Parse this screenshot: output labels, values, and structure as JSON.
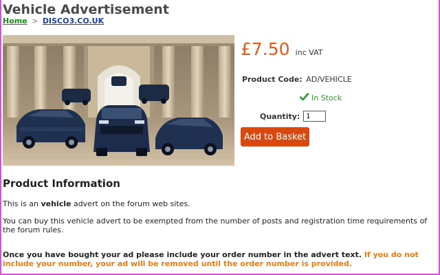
{
  "page": {
    "title": "Vehicle Advertisement"
  },
  "breadcrumb": {
    "home": "Home",
    "separator": ">",
    "current": "DISCO3.CO.UK"
  },
  "product": {
    "image_alt": "Range Rover vehicles in front of a stately building",
    "price": "£7.50",
    "price_suffix": "inc VAT",
    "code_label": "Product Code:",
    "code_value": "AD/VEHICLE",
    "stock_status": "In Stock",
    "quantity_label": "Quantity:",
    "quantity_value": "1",
    "add_button": "Add to Basket"
  },
  "info": {
    "heading": "Product Information",
    "p1_before": "This is an ",
    "p1_bold": "vehicle",
    "p1_after": " advert on the forum web sites.",
    "p2": "You can buy this vehicle advert to be exempted from the number of posts and registration time requirements of the forum rules.",
    "p3_bold": "Once you have bought your ad please include your order number in the advert text.",
    "p3_warning": "If you do not include your number, your ad will be removed until the order number is provided."
  },
  "colors": {
    "price": "#e05a1c",
    "button": "#d9480f",
    "stock": "#2a9a2a",
    "warning": "#f07a10",
    "home_link": "#1a8a1a",
    "site_link": "#1a3fa0",
    "frame": "#d94fd9"
  },
  "icons": {
    "stock": "check-icon"
  }
}
